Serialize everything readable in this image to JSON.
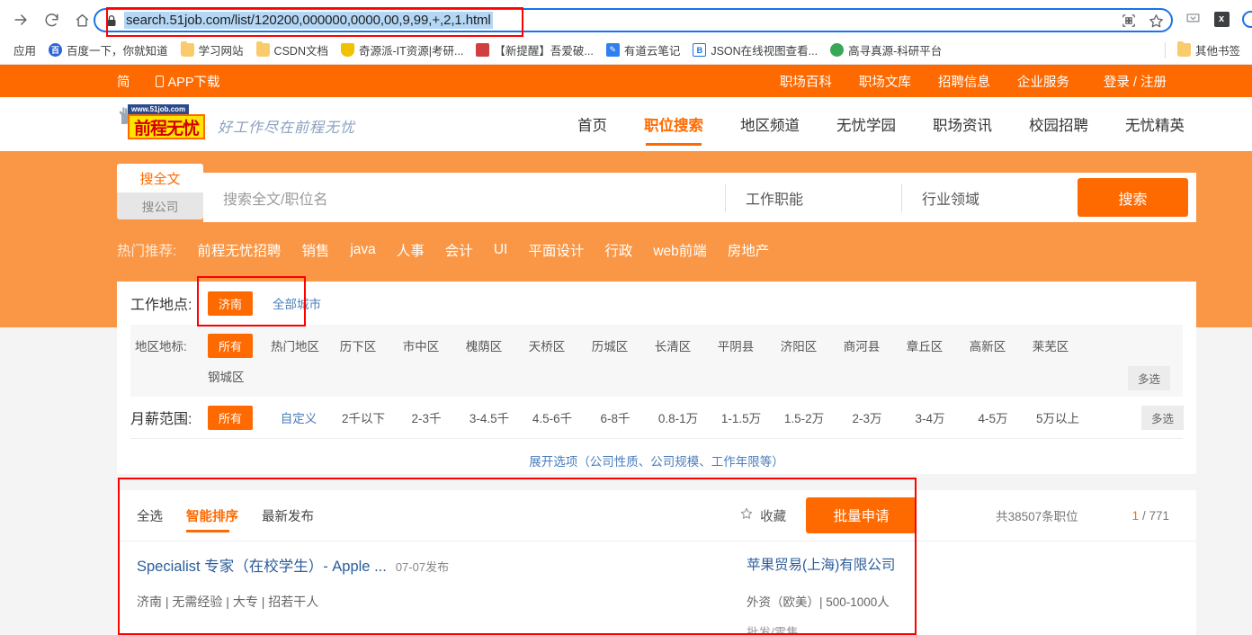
{
  "browser": {
    "url": "search.51job.com/list/120200,000000,0000,00,9,99,+,2,1.html",
    "nav": {
      "forward": "forward-arrow",
      "reload": "reload",
      "home": "home"
    },
    "omnibox_icons": [
      "qr-code-icon",
      "star-icon"
    ],
    "extensions": [
      "download-icon",
      "extension-x-icon",
      "profile-icon"
    ],
    "bookmarks_label": "应用",
    "bookmarks": [
      {
        "label": "百度一下，你就知道",
        "icon": "baidu-icon",
        "color": "#2b63d9"
      },
      {
        "label": "学习网站",
        "icon": "folder-icon",
        "color": "#f9cb6c"
      },
      {
        "label": "CSDN文档",
        "icon": "folder-icon",
        "color": "#f9cb6c"
      },
      {
        "label": "奇源派-IT资源|考研...",
        "icon": "shield-icon",
        "color": "#f2c200"
      },
      {
        "label": "【新提醒】吾爱破...",
        "icon": "grid-icon",
        "color": "#d04040"
      },
      {
        "label": "有道云笔记",
        "icon": "note-icon",
        "color": "#2f7ff0"
      },
      {
        "label": "JSON在线视图查看...",
        "icon": "brackets-b-icon",
        "color": "#1a73e8"
      },
      {
        "label": "高寻真源-科研平台",
        "icon": "globe-icon",
        "color": "#3aa757"
      }
    ],
    "other_bookmarks": "其他书签"
  },
  "topbar": {
    "lang": "简",
    "app_download": "APP下载",
    "links": [
      "职场百科",
      "职场文库",
      "招聘信息",
      "企业服务",
      "登录 / 注册"
    ]
  },
  "header": {
    "logo_url": "www.51job.com",
    "logo_text": "前程无忧",
    "slogan": "好工作尽在前程无忧",
    "nav": [
      {
        "label": "首页",
        "active": false
      },
      {
        "label": "职位搜索",
        "active": true
      },
      {
        "label": "地区频道",
        "active": false
      },
      {
        "label": "无忧学园",
        "active": false
      },
      {
        "label": "职场资讯",
        "active": false
      },
      {
        "label": "校园招聘",
        "active": false
      },
      {
        "label": "无忧精英",
        "active": false
      }
    ]
  },
  "search": {
    "tab_fulltext": "搜全文",
    "tab_company": "搜公司",
    "placeholder": "搜索全文/职位名",
    "value": "",
    "function_select": "工作职能",
    "industry_select": "行业领域",
    "button": "搜索",
    "hot_label": "热门推荐:",
    "hot_items": [
      "前程无忧招聘",
      "销售",
      "java",
      "人事",
      "会计",
      "UI",
      "平面设计",
      "行政",
      "web前端",
      "房地产"
    ]
  },
  "filters": {
    "city_label": "工作地点:",
    "city_selected": "济南",
    "city_all": "全部城市",
    "district_label": "地区地标:",
    "district_selected": "所有",
    "districts": [
      "热门地区",
      "历下区",
      "市中区",
      "槐荫区",
      "天桥区",
      "历城区",
      "长清区",
      "平阴县",
      "济阳区",
      "商河县",
      "章丘区",
      "高新区",
      "莱芜区",
      "钢城区"
    ],
    "district_multi": "多选",
    "salary_label": "月薪范围:",
    "salary_selected": "所有",
    "salary_custom": "自定义",
    "salaries": [
      "2千以下",
      "2-3千",
      "3-4.5千",
      "4.5-6千",
      "6-8千",
      "0.8-1万",
      "1-1.5万",
      "1.5-2万",
      "2-3万",
      "3-4万",
      "4-5万",
      "5万以上"
    ],
    "salary_multi": "多选",
    "expand": "展开选项（公司性质、公司规模、工作年限等）"
  },
  "results": {
    "select_all": "全选",
    "sort_smart": "智能排序",
    "sort_newest": "最新发布",
    "favorite": "收藏",
    "bulk_apply": "批量申请",
    "total": "共38507条职位",
    "page_current": "1",
    "page_sep": "/",
    "page_total": "771",
    "jobs": [
      {
        "title": "Specialist 专家（在校学生）- Apple ...",
        "date": "07-07发布",
        "meta": "济南 | 无需经验 | 大专 | 招若干人",
        "company": "苹果贸易(上海)有限公司",
        "company_meta": "外资（欧美）| 500-1000人",
        "industry": "批发/零售"
      }
    ]
  },
  "colors": {
    "brand_orange": "#ff6a00",
    "band_orange": "#f99746",
    "link_blue": "#2c5d9b",
    "annotation_red": "#ff0000"
  }
}
